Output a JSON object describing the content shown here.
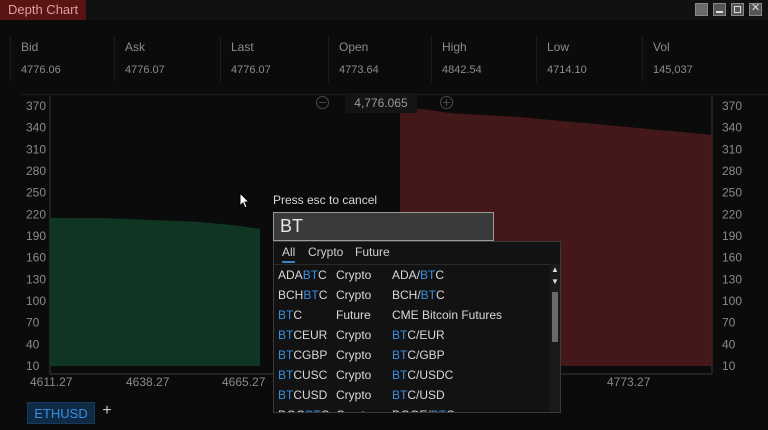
{
  "window": {
    "title": "Depth Chart"
  },
  "stats": {
    "headers": [
      "Bid",
      "Ask",
      "Last",
      "Open",
      "High",
      "Low",
      "Vol"
    ],
    "values": [
      "4776.06",
      "4776.07",
      "4776.07",
      "4773.64",
      "4842.54",
      "4714.10",
      "145,037"
    ]
  },
  "chart": {
    "price_label": "4,776.065",
    "y_ticks": [
      "370",
      "340",
      "310",
      "280",
      "250",
      "220",
      "190",
      "160",
      "130",
      "100",
      "70",
      "40",
      "10"
    ],
    "x_ticks": [
      "4611.27",
      "4638.27",
      "4665.27",
      "4773.27"
    ],
    "colors": {
      "bid": "#0f3a26",
      "ask": "#4a1a1a"
    }
  },
  "chart_data": {
    "type": "area",
    "series": [
      {
        "values": [
          215,
          215,
          215,
          214,
          212,
          210,
          205,
          200
        ],
        "x": [
          4611.27,
          4620,
          4630,
          4638.27,
          4650,
          4665.27,
          4680,
          4690
        ]
      },
      {
        "values": [
          370,
          360,
          355,
          350,
          345,
          340,
          335,
          330
        ],
        "x": [
          4760,
          4773.27,
          4790,
          4800,
          4810,
          4820,
          4830,
          4840
        ]
      }
    ],
    "ylim": [
      10,
      370
    ]
  },
  "search": {
    "hint": "Press esc to cancel",
    "value": "BT",
    "filters": [
      "All",
      "Crypto",
      "Future"
    ],
    "results": [
      {
        "pre": "ADA",
        "hl": "BT",
        "post": "C",
        "type": "Crypto",
        "dpre": "ADA/",
        "dhl": "BT",
        "dpost": "C"
      },
      {
        "pre": "BCH",
        "hl": "BT",
        "post": "C",
        "type": "Crypto",
        "dpre": "BCH/",
        "dhl": "BT",
        "dpost": "C"
      },
      {
        "pre": "",
        "hl": "BT",
        "post": "C",
        "type": "Future",
        "dpre": "CME Bitcoin Futures",
        "dhl": "",
        "dpost": ""
      },
      {
        "pre": "",
        "hl": "BT",
        "post": "CEUR",
        "type": "Crypto",
        "dpre": "",
        "dhl": "BT",
        "dpost": "C/EUR"
      },
      {
        "pre": "",
        "hl": "BT",
        "post": "CGBP",
        "type": "Crypto",
        "dpre": "",
        "dhl": "BT",
        "dpost": "C/GBP"
      },
      {
        "pre": "",
        "hl": "BT",
        "post": "CUSC",
        "type": "Crypto",
        "dpre": "",
        "dhl": "BT",
        "dpost": "C/USDC"
      },
      {
        "pre": "",
        "hl": "BT",
        "post": "CUSD",
        "type": "Crypto",
        "dpre": "",
        "dhl": "BT",
        "dpost": "C/USD"
      },
      {
        "pre": "DOG",
        "hl": "BT",
        "post": "C",
        "type": "Crypto",
        "dpre": "DOGE/",
        "dhl": "BT",
        "dpost": "C"
      }
    ]
  },
  "bottom": {
    "tab_label": "ETHUSD",
    "add_label": "+"
  }
}
